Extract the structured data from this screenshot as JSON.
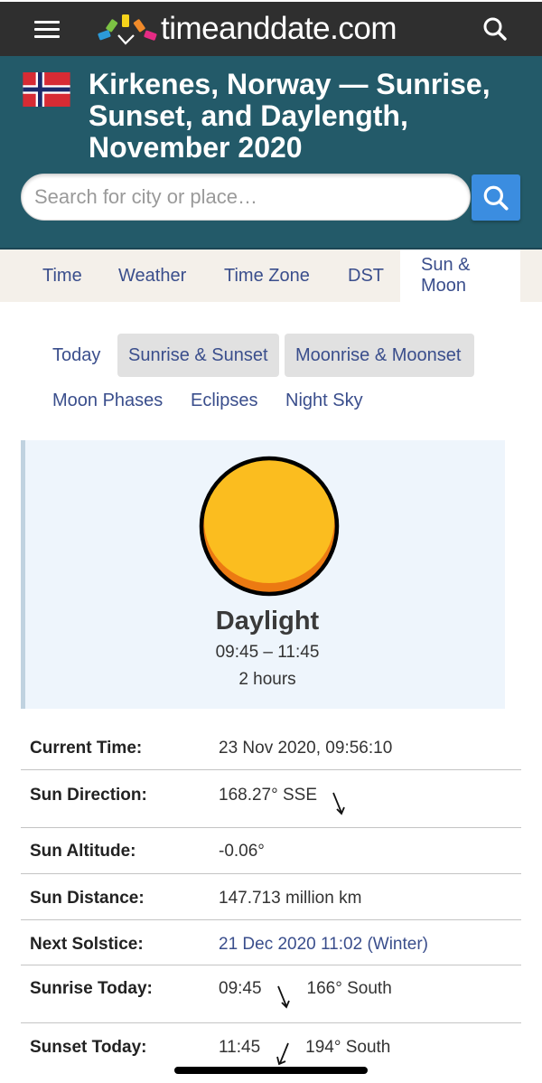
{
  "topbar": {
    "menu_icon": "hamburger-menu-icon",
    "logo_text": "timeanddate.com",
    "logo_colors": [
      "#2c9ad8",
      "#7cc243",
      "#f6d31b",
      "#f08a2a",
      "#e52b84"
    ],
    "search_icon": "search-icon"
  },
  "hero": {
    "flag": "norway-flag-icon",
    "title": "Kirkenes, Norway — Sunrise, Sunset, and Daylength, November 2020",
    "search": {
      "value": "",
      "placeholder": "Search for city or place…"
    },
    "search_button_icon": "search-icon"
  },
  "main_nav": {
    "tabs": [
      {
        "label": "Time",
        "active": false
      },
      {
        "label": "Weather",
        "active": false
      },
      {
        "label": "Time Zone",
        "active": false
      },
      {
        "label": "DST",
        "active": false
      },
      {
        "label": "Sun & Moon",
        "active": true
      }
    ]
  },
  "sub_nav": {
    "items": [
      {
        "label": "Today",
        "active": false
      },
      {
        "label": "Sunrise & Sunset",
        "active": true
      },
      {
        "label": "Moonrise & Moonset",
        "active": true
      },
      {
        "label": "Moon Phases",
        "active": false
      },
      {
        "label": "Eclipses",
        "active": false
      },
      {
        "label": "Night Sky",
        "active": false
      }
    ]
  },
  "daylight_card": {
    "icon": "sun-icon",
    "title": "Daylight",
    "time_range": "09:45 – 11:45",
    "duration": "2 hours"
  },
  "info_table": {
    "rows": [
      {
        "label": "Current Time:",
        "value": "23 Nov 2020, 09:56:10"
      },
      {
        "label": "Sun Direction:",
        "value": "168.27° SSE",
        "arrow": "arrow-down-right-icon"
      },
      {
        "label": "Sun Altitude:",
        "value": "-0.06°"
      },
      {
        "label": "Sun Distance:",
        "value": "147.713 million km"
      },
      {
        "label": "Next Solstice:",
        "value": "21 Dec 2020 11:02 (Winter)",
        "is_link": true
      },
      {
        "label": "Sunrise Today:",
        "value": "09:45",
        "arrow": "arrow-down-right-icon",
        "extra": "166° South"
      },
      {
        "label": "Sunset Today:",
        "value": "11:45",
        "arrow": "arrow-down-left-icon",
        "extra": "194° South"
      }
    ]
  },
  "colors": {
    "topbar_bg": "#2f2f2f",
    "hero_bg": "#235a69",
    "nav_bg": "#f4f0ea",
    "link": "#3a4e8c",
    "search_button": "#3b8de0",
    "card_bg": "#eef5fc",
    "sun_fill": "#fbbd1f",
    "sun_shadow": "#ec7a12"
  }
}
